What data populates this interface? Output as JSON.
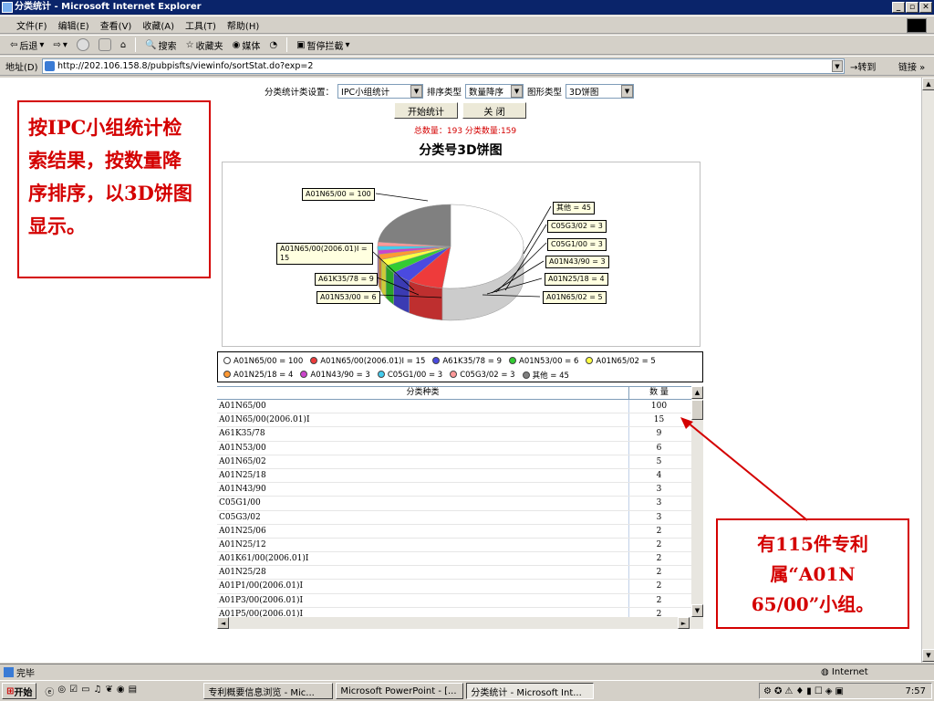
{
  "window": {
    "title": "分类统计 - Microsoft Internet Explorer"
  },
  "menu": [
    "文件(F)",
    "编辑(E)",
    "查看(V)",
    "收藏(A)",
    "工具(T)",
    "帮助(H)"
  ],
  "toolbar": {
    "back": "后退",
    "search": "搜索",
    "favorites": "收藏夹",
    "media": "媒体",
    "blocker": "暂停拦截"
  },
  "address": {
    "label": "地址(D)",
    "url": "http://202.106.158.8/pubpisfts/viewinfo/sortStat.do?exp=2",
    "go": "转到",
    "links": "链接"
  },
  "controls": {
    "setting_label": "分类统计类设置：",
    "setting_value": "IPC小组统计",
    "sort_label": "排序类型",
    "sort_value": "数量降序",
    "graph_label": "图形类型",
    "graph_value": "3D饼图",
    "start_button": "开始统计",
    "close_button": "关 闭"
  },
  "summary": "总数量：193 分类数量:159",
  "chart_data": {
    "type": "pie",
    "title": "分类号3D饼图",
    "slices": [
      {
        "label": "A01N65/00",
        "value": 100,
        "color": "#ffffff"
      },
      {
        "label": "A01N65/00(2006.01)I",
        "value": 15,
        "color": "#ee3b3b"
      },
      {
        "label": "A61K35/78",
        "value": 9,
        "color": "#4a4ae0"
      },
      {
        "label": "A01N53/00",
        "value": 6,
        "color": "#33cc33"
      },
      {
        "label": "A01N65/02",
        "value": 5,
        "color": "#ffff44"
      },
      {
        "label": "A01N25/18",
        "value": 4,
        "color": "#ff9933"
      },
      {
        "label": "A01N43/90",
        "value": 3,
        "color": "#cc44cc"
      },
      {
        "label": "C05G1/00",
        "value": 3,
        "color": "#44ccee"
      },
      {
        "label": "C05G3/02",
        "value": 3,
        "color": "#ff9999"
      },
      {
        "label": "其他",
        "value": 45,
        "color": "#808080"
      }
    ],
    "chart_labels": [
      "A01N65/00 = 100",
      "A01N65/00(2006.01)I = 15",
      "A61K35/78 = 9",
      "A01N53/00 = 6",
      "其他 = 45",
      "C05G3/02 = 3",
      "C05G1/00 = 3",
      "A01N43/90 = 3",
      "A01N25/18 = 4",
      "A01N65/02 = 5"
    ],
    "legend_rows": [
      [
        "A01N65/00 = 100",
        "A01N65/00(2006.01)I = 15",
        "A61K35/78 = 9",
        "A01N53/00 = 6",
        "A01N65/02 = 5"
      ],
      [
        "A01N25/18 = 4",
        "A01N43/90 = 3",
        "C05G1/00 = 3",
        "C05G3/02 = 3",
        "其他 = 45"
      ]
    ],
    "legend_colors": [
      [
        "#ffffff",
        "#ee3b3b",
        "#4a4ae0",
        "#33cc33",
        "#ffff44"
      ],
      [
        "#ff9933",
        "#cc44cc",
        "#44ccee",
        "#ff9999",
        "#808080"
      ]
    ]
  },
  "table": {
    "headers": [
      "分类种类",
      "数 量"
    ],
    "rows": [
      [
        "A01N65/00",
        "100"
      ],
      [
        "A01N65/00(2006.01)I",
        "15"
      ],
      [
        "A61K35/78",
        "9"
      ],
      [
        "A01N53/00",
        "6"
      ],
      [
        "A01N65/02",
        "5"
      ],
      [
        "A01N25/18",
        "4"
      ],
      [
        "A01N43/90",
        "3"
      ],
      [
        "C05G1/00",
        "3"
      ],
      [
        "C05G3/02",
        "3"
      ],
      [
        "A01N25/06",
        "2"
      ],
      [
        "A01N25/12",
        "2"
      ],
      [
        "A01K61/00(2006.01)I",
        "2"
      ],
      [
        "A01N25/28",
        "2"
      ],
      [
        "A01P1/00(2006.01)I",
        "2"
      ],
      [
        "A01P3/00(2006.01)I",
        "2"
      ],
      [
        "A01P5/00(2006.01)I",
        "2"
      ]
    ]
  },
  "callouts": {
    "left": "按IPC小组统计检索结果，按数量降序排序，以3D饼图显示。",
    "right": "有115件专利属“A01N 65/00”小组。"
  },
  "status": {
    "text": "完毕",
    "zone": "Internet"
  },
  "taskbar": {
    "start": "开始",
    "tasks": [
      "专利概要信息浏览 - Mic...",
      "Microsoft PowerPoint - [...",
      "分类统计 - Microsoft Int..."
    ],
    "clock": "7:57"
  }
}
